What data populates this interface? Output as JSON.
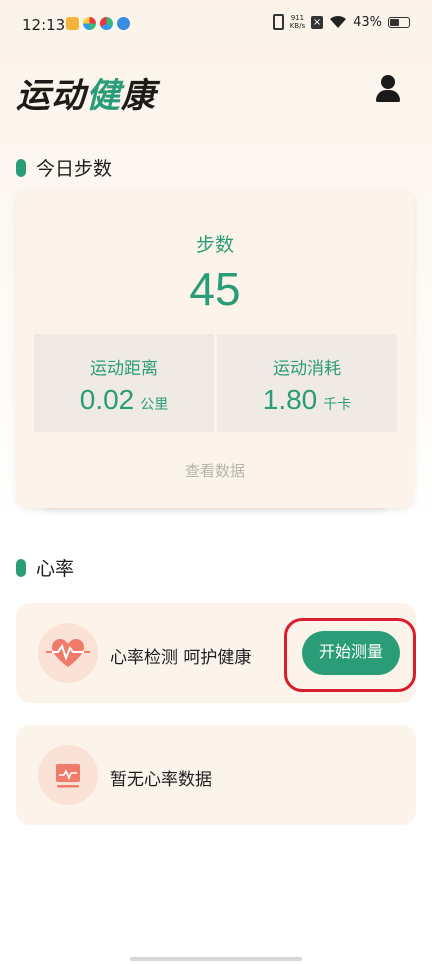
{
  "status_bar": {
    "time": "12:13",
    "net_speed_value": "911",
    "net_speed_unit": "KB/s",
    "battery": "43%",
    "battery_fraction": 0.43,
    "icons": [
      "app-notification-icon",
      "pinwheel-icon",
      "pinwheel-icon",
      "browser-icon",
      "vibrate-icon",
      "sim-off-icon",
      "wifi-icon",
      "battery-icon"
    ]
  },
  "header": {
    "title_part1": "运动",
    "title_part2": "健",
    "title_part3": "康",
    "avatar_icon": "user-icon"
  },
  "steps_section": {
    "title": "今日步数",
    "card": {
      "label": "步数",
      "value": "45",
      "distance": {
        "title": "运动距离",
        "value": "0.02",
        "unit": "公里"
      },
      "calories": {
        "title": "运动消耗",
        "value": "1.80",
        "unit": "千卡"
      },
      "view_data_label": "查看数据"
    }
  },
  "heart_section": {
    "title": "心率",
    "measure_card": {
      "icon": "heart-rate-icon",
      "text": "心率检测 呵护健康",
      "button_label": "开始测量"
    },
    "empty_card": {
      "icon": "monitor-icon",
      "text": "暂无心率数据"
    }
  },
  "colors": {
    "accent": "#2a9d78",
    "card_bg": "#fcf3ea",
    "icon_bg": "#fbe2d6",
    "icon_red": "#f07b6a",
    "highlight": "#d81e2c"
  }
}
